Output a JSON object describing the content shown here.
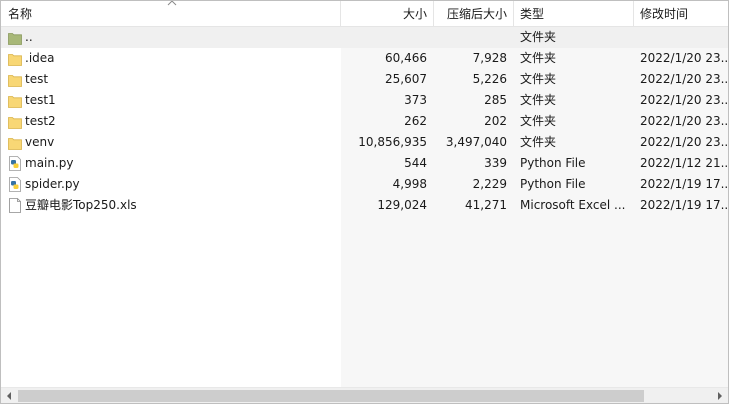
{
  "columns": {
    "name": "名称",
    "size": "大小",
    "compressed": "压缩后大小",
    "type": "类型",
    "modified": "修改时间"
  },
  "files": [
    {
      "name": "..",
      "size": "",
      "compressed": "",
      "type": "文件夹",
      "modified": "",
      "icon": "parent-folder-icon"
    },
    {
      "name": ".idea",
      "size": "60,466",
      "compressed": "7,928",
      "type": "文件夹",
      "modified": "2022/1/20 23...",
      "icon": "folder-icon"
    },
    {
      "name": "test",
      "size": "25,607",
      "compressed": "5,226",
      "type": "文件夹",
      "modified": "2022/1/20 23...",
      "icon": "folder-icon"
    },
    {
      "name": "test1",
      "size": "373",
      "compressed": "285",
      "type": "文件夹",
      "modified": "2022/1/20 23...",
      "icon": "folder-icon"
    },
    {
      "name": "test2",
      "size": "262",
      "compressed": "202",
      "type": "文件夹",
      "modified": "2022/1/20 23...",
      "icon": "folder-icon"
    },
    {
      "name": "venv",
      "size": "10,856,935",
      "compressed": "3,497,040",
      "type": "文件夹",
      "modified": "2022/1/20 23...",
      "icon": "folder-icon"
    },
    {
      "name": "main.py",
      "size": "544",
      "compressed": "339",
      "type": "Python File",
      "modified": "2022/1/12 21...",
      "icon": "python-file-icon"
    },
    {
      "name": "spider.py",
      "size": "4,998",
      "compressed": "2,229",
      "type": "Python File",
      "modified": "2022/1/19 17...",
      "icon": "python-file-icon"
    },
    {
      "name": "豆瓣电影Top250.xls",
      "size": "129,024",
      "compressed": "41,271",
      "type": "Microsoft Excel ...",
      "modified": "2022/1/19 17...",
      "icon": "generic-file-icon"
    }
  ],
  "colors": {
    "folder": "#f8d775",
    "parent_folder": "#a8b878",
    "python_blue": "#3672a4",
    "python_yellow": "#f7cf3a"
  }
}
